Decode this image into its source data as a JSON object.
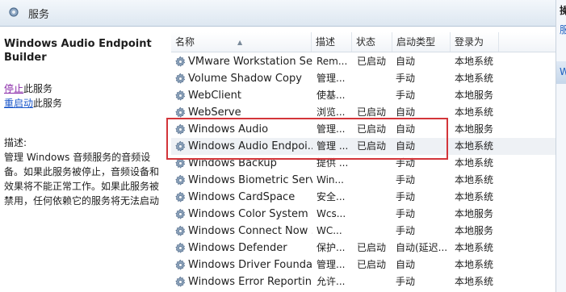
{
  "window": {
    "title": "服务"
  },
  "right_pane": {
    "item1": "操",
    "item2": "服",
    "item3": "W"
  },
  "details": {
    "service_title": "Windows Audio Endpoint Builder",
    "stop_link": "停止",
    "stop_suffix": "此服务",
    "restart_link": "重启动",
    "restart_suffix": "此服务",
    "desc_label": "描述:",
    "desc_text": "管理 Windows 音频服务的音频设备。如果此服务被停止，音频设备和效果将不能正常工作。如果此服务被禁用，任何依赖它的服务将无法启动"
  },
  "columns": {
    "name": "名称",
    "description": "描述",
    "status": "状态",
    "startup": "启动类型",
    "logon": "登录为"
  },
  "rows": [
    {
      "name": "VMware Workstation Se...",
      "desc": "Rem...",
      "status": "已启动",
      "startup": "自动",
      "logon": "本地系统"
    },
    {
      "name": "Volume Shadow Copy",
      "desc": "管理...",
      "status": "",
      "startup": "手动",
      "logon": "本地系统"
    },
    {
      "name": "WebClient",
      "desc": "使基...",
      "status": "",
      "startup": "手动",
      "logon": "本地服务"
    },
    {
      "name": "WebServe",
      "desc": "浏览...",
      "status": "已启动",
      "startup": "自动",
      "logon": "本地系统"
    },
    {
      "name": "Windows Audio",
      "desc": "管理...",
      "status": "已启动",
      "startup": "自动",
      "logon": "本地服务"
    },
    {
      "name": "Windows Audio Endpoi...",
      "desc": "管理 ...",
      "status": "已启动",
      "startup": "自动",
      "logon": "本地系统"
    },
    {
      "name": "Windows Backup",
      "desc": "提供 ...",
      "status": "",
      "startup": "手动",
      "logon": "本地系统"
    },
    {
      "name": "Windows Biometric Serv...",
      "desc": "Win...",
      "status": "",
      "startup": "手动",
      "logon": "本地系统"
    },
    {
      "name": "Windows CardSpace",
      "desc": "安全...",
      "status": "",
      "startup": "手动",
      "logon": "本地系统"
    },
    {
      "name": "Windows Color System",
      "desc": "Wcs...",
      "status": "",
      "startup": "手动",
      "logon": "本地服务"
    },
    {
      "name": "Windows Connect Now ...",
      "desc": "WC...",
      "status": "",
      "startup": "手动",
      "logon": "本地服务"
    },
    {
      "name": "Windows Defender",
      "desc": "保护...",
      "status": "已启动",
      "startup": "自动(延迟...",
      "logon": "本地系统"
    },
    {
      "name": "Windows Driver Founda...",
      "desc": "管理...",
      "status": "已启动",
      "startup": "自动",
      "logon": "本地系统"
    },
    {
      "name": "Windows Error Reportin...",
      "desc": "允许...",
      "status": "",
      "startup": "手动",
      "logon": "本地系统"
    }
  ],
  "selected_row_index": 5,
  "colors": {
    "highlight_border": "#d3353a",
    "link": "#1a56c9",
    "visited_link": "#8a2aa9"
  },
  "icons": {
    "window": "services-icon",
    "row": "gear-icon"
  }
}
